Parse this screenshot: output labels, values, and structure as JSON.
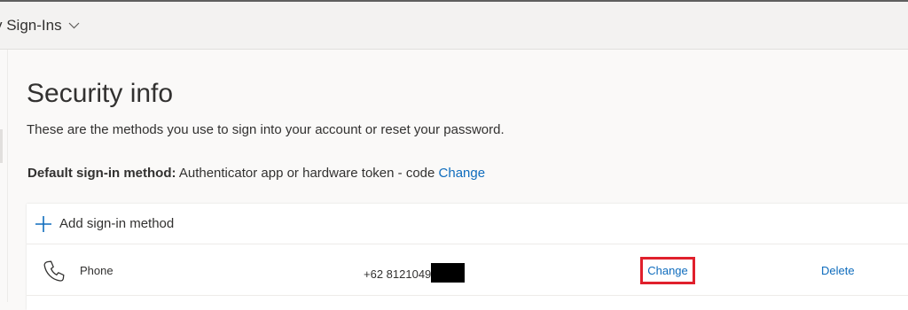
{
  "topbar": {
    "title": "y Sign-Ins"
  },
  "page": {
    "title": "Security info",
    "description": "These are the methods you use to sign into your account or reset your password.",
    "default_method": {
      "label": "Default sign-in method:",
      "value": "Authenticator app or hardware token - code",
      "change_label": "Change"
    }
  },
  "methods": {
    "add_label": "Add sign-in method",
    "rows": [
      {
        "icon": "phone-icon",
        "name": "Phone",
        "value": "+62 8121049",
        "value_redacted": true,
        "change_label": "Change",
        "delete_label": "Delete"
      }
    ]
  },
  "colors": {
    "link": "#0f6cbd",
    "highlight_box": "#e0202c",
    "accent_plus": "#0f6cbd"
  }
}
